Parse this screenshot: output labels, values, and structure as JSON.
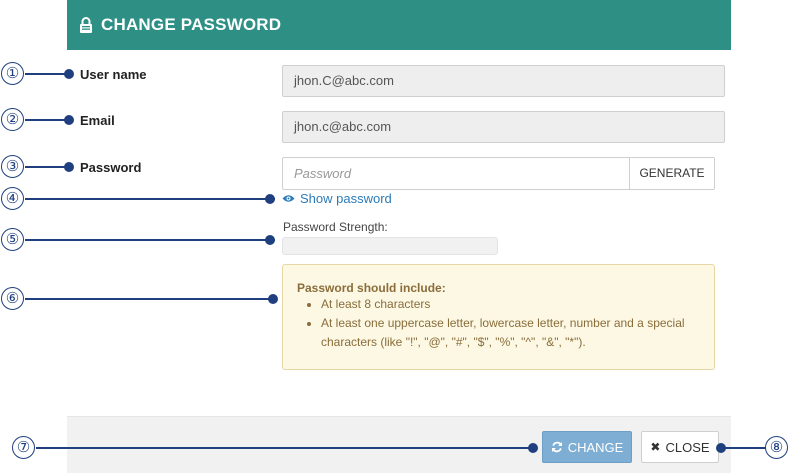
{
  "dialog": {
    "title": "CHANGE PASSWORD",
    "icon": "lock-icon",
    "header_color": "#2e8f85"
  },
  "form": {
    "username_label": "User name",
    "username_value": "jhon.C@abc.com",
    "email_label": "Email",
    "email_value": "jhon.c@abc.com",
    "password_label": "Password",
    "password_placeholder": "Password",
    "generate_label": "GENERATE",
    "show_password_label": "Show password",
    "strength_label": "Password Strength:",
    "strength_level": 0
  },
  "notice": {
    "heading": "Password should include:",
    "items": [
      "At least 8 characters",
      "At least one uppercase letter, lowercase letter, number and a special characters (like \"!\", \"@\", \"#\", \"$\", \"%\", \"^\", \"&\", \"*\")."
    ]
  },
  "footer": {
    "change_label": "CHANGE",
    "close_label": "CLOSE"
  },
  "callouts": [
    "①",
    "②",
    "③",
    "④",
    "⑤",
    "⑥",
    "⑦",
    "⑧"
  ]
}
